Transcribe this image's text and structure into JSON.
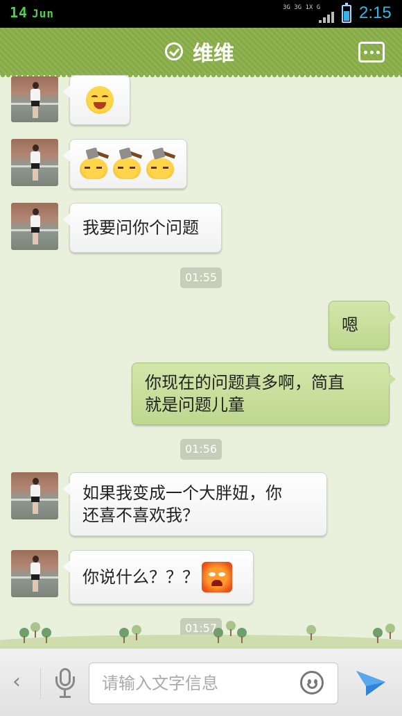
{
  "status_bar": {
    "day": "14",
    "month": "Jun",
    "network": "3G 3G 1X G",
    "time": "2:15"
  },
  "header": {
    "title": "维维",
    "accent_color": "#8bb04a"
  },
  "messages": [
    {
      "side": "in",
      "type": "emoji",
      "emoji": "laugh-emoji"
    },
    {
      "side": "in",
      "type": "emoji",
      "emoji": "hammer-emoji x3"
    },
    {
      "side": "in",
      "type": "text",
      "text": "我要问你个问题"
    },
    {
      "type": "time",
      "text": "01:55"
    },
    {
      "side": "out",
      "type": "text",
      "text": "嗯"
    },
    {
      "side": "out",
      "type": "text",
      "line1": "你现在的问题真多啊，简直",
      "line2": "就是问题儿童"
    },
    {
      "type": "time",
      "text": "01:56"
    },
    {
      "side": "in",
      "type": "text",
      "line1": "如果我变成一个大胖妞，你",
      "line2": "还喜不喜欢我？"
    },
    {
      "side": "in",
      "type": "text",
      "text": "你说什么？？？",
      "emoji": "angry-emoji"
    },
    {
      "type": "time",
      "text": "01:57"
    }
  ],
  "input_bar": {
    "placeholder": "请输入文字信息"
  }
}
